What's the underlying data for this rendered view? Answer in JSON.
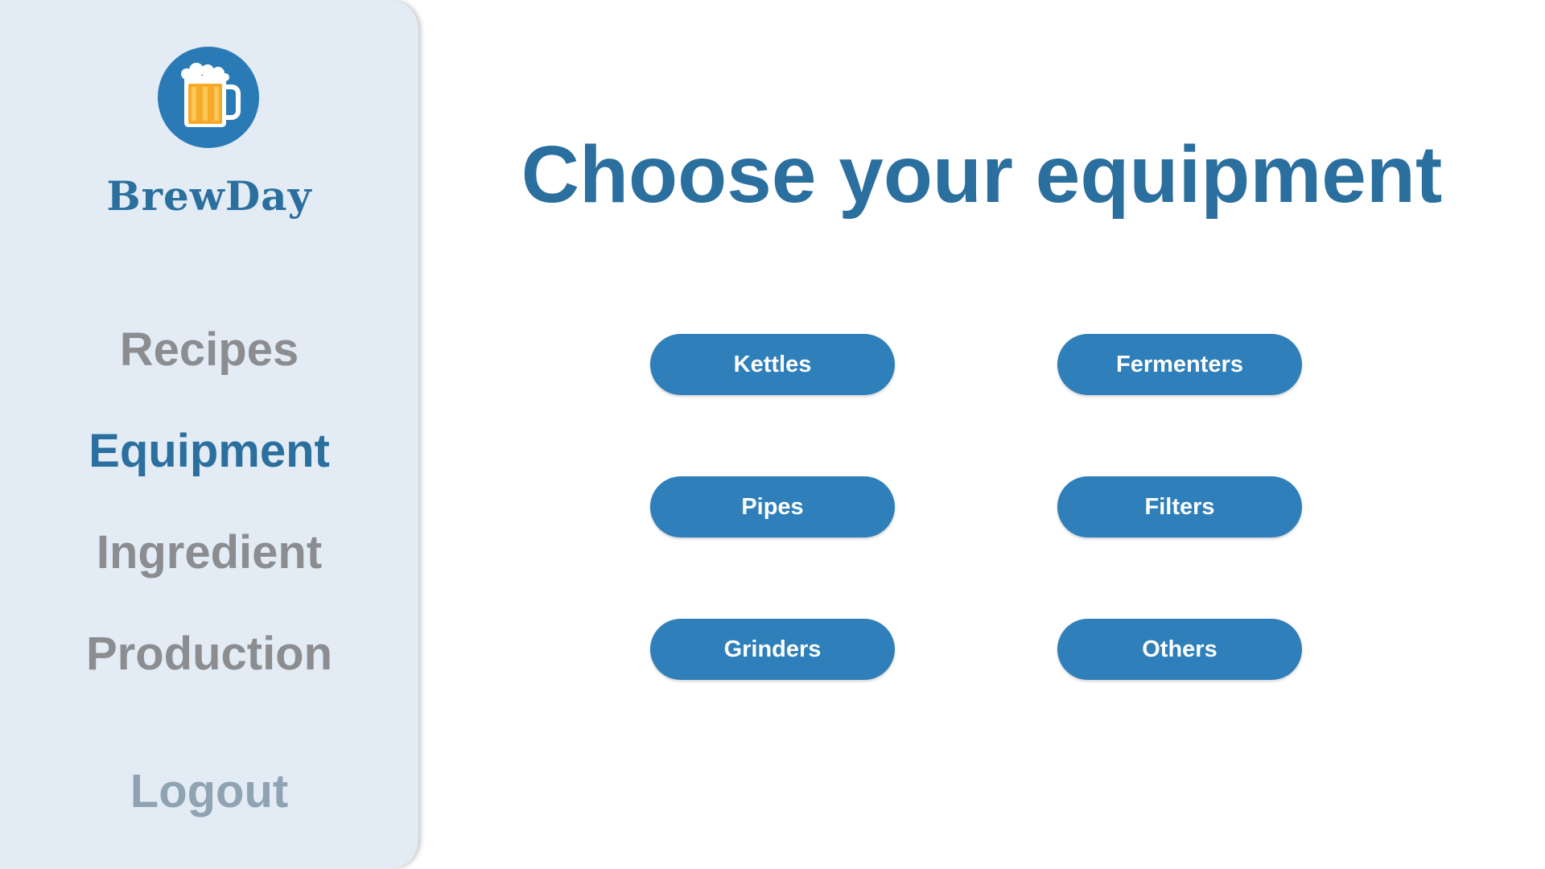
{
  "brand": {
    "name": "BrewDay",
    "logo_icon": "beer-mug-icon"
  },
  "sidebar": {
    "items": [
      {
        "label": "Recipes",
        "active": false
      },
      {
        "label": "Equipment",
        "active": true
      },
      {
        "label": "Ingredient",
        "active": false
      },
      {
        "label": "Production",
        "active": false
      }
    ],
    "logout_label": "Logout"
  },
  "main": {
    "title": "Choose your equipment",
    "buttons": [
      {
        "label": "Kettles"
      },
      {
        "label": "Fermenters"
      },
      {
        "label": "Pipes"
      },
      {
        "label": "Filters"
      },
      {
        "label": "Grinders"
      },
      {
        "label": "Others"
      }
    ]
  },
  "colors": {
    "sidebar_bg": "#e3ecf4",
    "accent": "#2b6f9f",
    "button": "#2e7fba",
    "nav_inactive": "#8b8d90",
    "logout": "#8fa3b2"
  }
}
